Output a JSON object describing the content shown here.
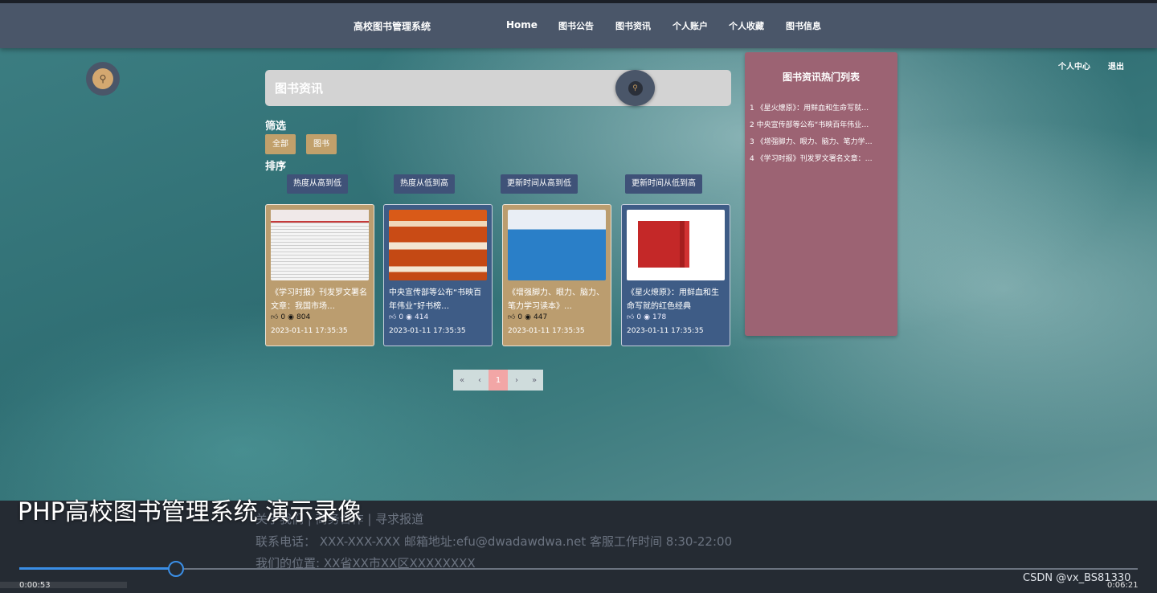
{
  "nav": {
    "brand": "高校图书管理系统",
    "items": [
      {
        "label": "Home"
      },
      {
        "label": "图书公告"
      },
      {
        "label": "图书资讯"
      },
      {
        "label": "个人账户"
      },
      {
        "label": "个人收藏"
      },
      {
        "label": "图书信息"
      }
    ]
  },
  "search": {
    "placeholder": "图书资讯"
  },
  "filter": {
    "label": "筛选",
    "options": [
      "全部",
      "图书"
    ]
  },
  "sort": {
    "label": "排序",
    "options": [
      "热度从高到低",
      "热度从低到高",
      "更新时间从高到低",
      "更新时间从低到高"
    ]
  },
  "cards": [
    {
      "title": "《学习时报》刊发罗文署名文章：我国市场…",
      "likes": "0",
      "views": "804",
      "date": "2023-01-11 17:35:35"
    },
    {
      "title": "中央宣传部等公布“书映百年伟业”好书榜…",
      "likes": "0",
      "views": "414",
      "date": "2023-01-11 17:35:35"
    },
    {
      "title": "《增强脚力、眼力、脑力、笔力学习读本》…",
      "likes": "0",
      "views": "447",
      "date": "2023-01-11 17:35:35"
    },
    {
      "title": "《星火燎原》：用鲜血和生命写就的红色经典",
      "likes": "0",
      "views": "178",
      "date": "2023-01-11 17:35:35"
    }
  ],
  "pager": {
    "first": "«",
    "prev": "‹",
    "current": "1",
    "next": "›",
    "last": "»"
  },
  "hot": {
    "title": "图书资讯热门列表",
    "items": [
      "1 《星火燎原》：用鲜血和生命写就…",
      "2 中央宣传部等公布“书映百年伟业…",
      "3 《增强脚力、眼力、脑力、笔力学…",
      "4 《学习时报》刊发罗文署名文章：…"
    ]
  },
  "user": {
    "center": "个人中心",
    "logout": "退出"
  },
  "footer": {
    "line1": "关于我们 | 商务合作 | 寻求报道",
    "line2": "联系电话： XXX-XXX-XXX 邮箱地址:efu@dwadawdwa.net 客服工作时间 8:30-22:00",
    "line3": "我们的位置: XX省XX市XX区XXXXXXXX"
  },
  "video": {
    "title": "PHP高校图书管理系统 演示录像",
    "time_now": "0:00:53",
    "time_total": "0:06:21",
    "progress": 0.14,
    "watermark": "CSDN @vx_BS81330"
  },
  "colors": {
    "nav": "#4a5669",
    "tan": "#bb9d6f",
    "navy": "#3e5c86",
    "hot_panel": "#9c6373",
    "pager_active": "#f2a6a6"
  }
}
